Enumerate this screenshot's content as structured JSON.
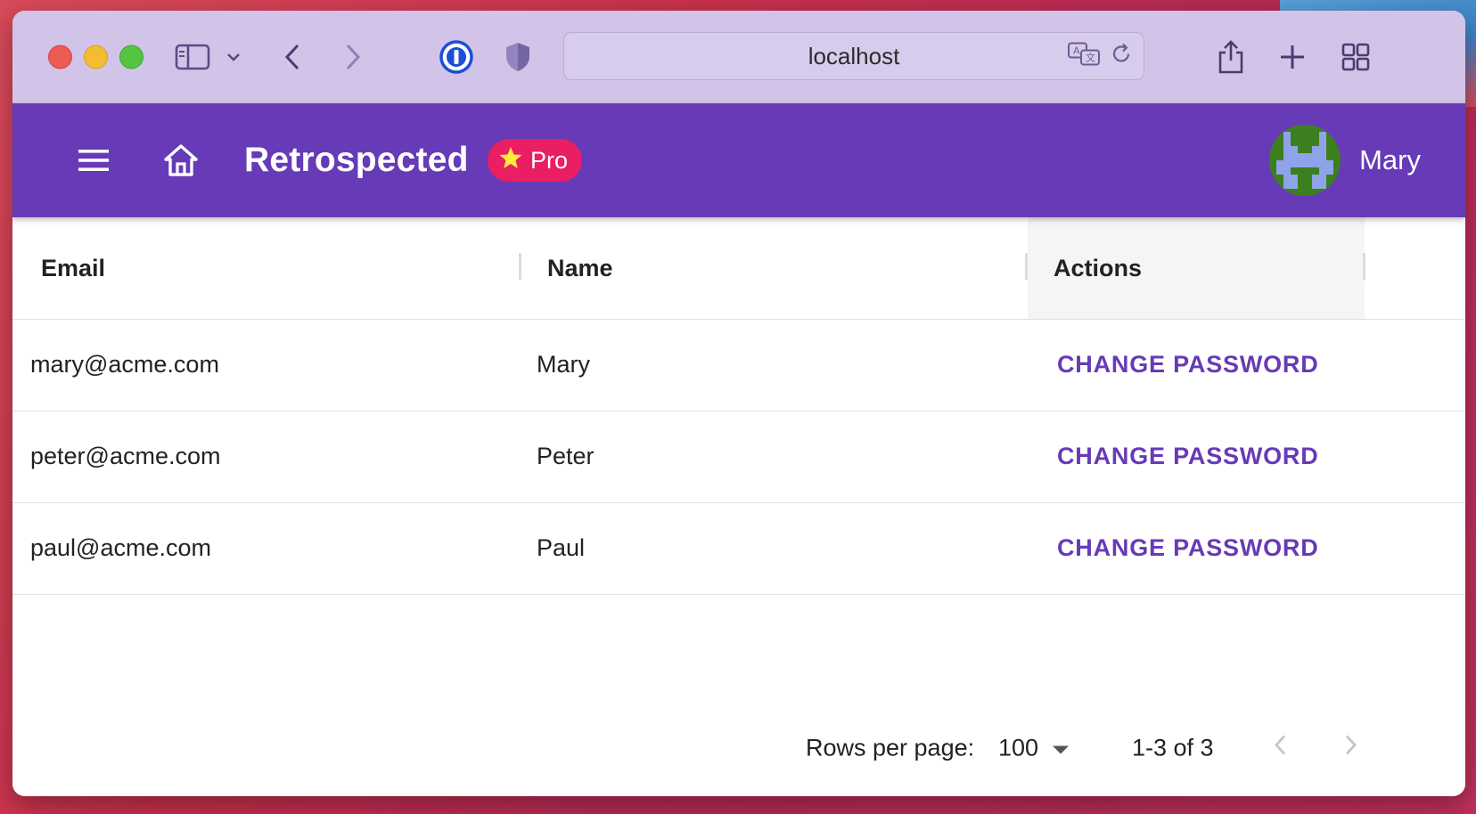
{
  "browser": {
    "url": "localhost",
    "icons": [
      "sidebar-icon",
      "chevron-down-icon",
      "back-icon",
      "forward-icon",
      "password-manager-icon",
      "privacy-shield-icon",
      "translate-icon",
      "reload-icon",
      "share-icon",
      "new-tab-icon",
      "tab-overview-icon"
    ]
  },
  "appbar": {
    "title": "Retrospected",
    "pro_label": "Pro",
    "user_name": "Mary",
    "color": "#673ab7",
    "badge_color": "#ea1e63"
  },
  "table": {
    "columns": [
      "Email",
      "Name",
      "Actions"
    ],
    "rows": [
      {
        "email": "mary@acme.com",
        "name": "Mary",
        "action": "CHANGE PASSWORD"
      },
      {
        "email": "peter@acme.com",
        "name": "Peter",
        "action": "CHANGE PASSWORD"
      },
      {
        "email": "paul@acme.com",
        "name": "Paul",
        "action": "CHANGE PASSWORD"
      }
    ]
  },
  "pagination": {
    "rows_per_page_label": "Rows per page:",
    "rows_per_page_value": "100",
    "range": "1-3 of 3"
  }
}
